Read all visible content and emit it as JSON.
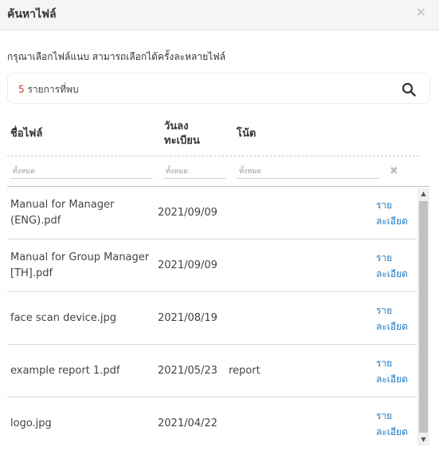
{
  "dialog": {
    "title": "ค้นหาไฟล์",
    "close_symbol": "×"
  },
  "instruction": "กรุณาเลือกไฟล์แนบ สามารถเลือกได้ครั้งละหลายไฟล์",
  "search": {
    "result_count": "5",
    "result_label": " รายการที่พบ",
    "icon": "search-icon"
  },
  "table": {
    "headers": {
      "name": "ชื่อไฟล์",
      "date": "วันลงทะเบียน",
      "note": "โน้ต"
    },
    "filters": {
      "name_placeholder": "ทั้งหมด",
      "date_placeholder": "ทั้งหมด",
      "note_placeholder": "ทั้งหมด",
      "clear_symbol": "✖"
    },
    "rows": [
      {
        "name": "Manual for Manager (ENG).pdf",
        "date": "2021/09/09",
        "note": "",
        "detail": "รายละเอียด"
      },
      {
        "name": "Manual for Group Manager [TH].pdf",
        "date": "2021/09/09",
        "note": "",
        "detail": "รายละเอียด"
      },
      {
        "name": "face scan device.jpg",
        "date": "2021/08/19",
        "note": "",
        "detail": "รายละเอียด"
      },
      {
        "name": "example report 1.pdf",
        "date": "2021/05/23",
        "note": "report",
        "detail": "รายละเอียด"
      },
      {
        "name": "logo.jpg",
        "date": "2021/04/22",
        "note": "",
        "detail": "รายละเอียด"
      }
    ]
  },
  "scrollbar": {
    "up_symbol": "▲",
    "down_symbol": "▼"
  },
  "colors": {
    "accent_link": "#1e7ac2",
    "count_highlight": "#c0392b",
    "header_bg": "#f5f5f5"
  }
}
